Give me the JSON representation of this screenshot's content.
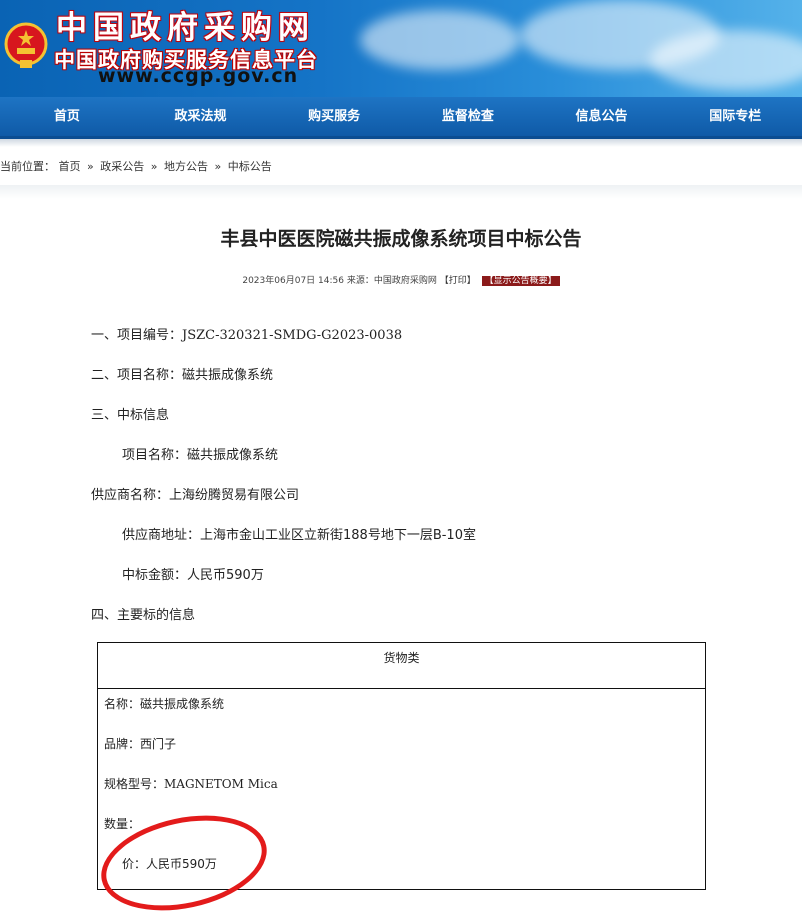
{
  "header": {
    "site_title": "中国政府采购网",
    "site_subtitle": "中国政府购买服务信息平台",
    "site_url": "www.ccgp.gov.cn"
  },
  "nav": {
    "items": [
      "首页",
      "政采法规",
      "购买服务",
      "监督检查",
      "信息公告",
      "国际专栏"
    ]
  },
  "breadcrumb": {
    "prefix": "当前位置：",
    "items": [
      "首页",
      "政采公告",
      "地方公告",
      "中标公告"
    ],
    "separator": "»"
  },
  "article": {
    "title": "丰县中医医院磁共振成像系统项目中标公告",
    "meta_date": "2023年06月07日 14:56",
    "meta_source": "来源：中国政府采购网",
    "print_label": "【打印】",
    "show_tag": "【显示公告概要】",
    "lines": {
      "project_no": "一、项目编号：JSZC-320321-SMDG-G2023-0038",
      "project_name": "二、项目名称：磁共振成像系统",
      "award_info": "三、中标信息",
      "award_project_name": "项目名称：磁共振成像系统",
      "supplier_name": "供应商名称：上海纷腾贸易有限公司",
      "supplier_addr": "供应商地址：上海市金山工业区立新街188号地下一层B-10室",
      "award_amount": "中标金额：人民币590万",
      "main_info": "四、主要标的信息"
    },
    "goods_table": {
      "header": "货物类",
      "name": "名称：磁共振成像系统",
      "brand": "品牌：西门子",
      "model": "规格型号：MAGNETOM Mica",
      "quantity": "数量：",
      "unit_price": "价：人民币590万"
    }
  },
  "colors": {
    "nav_bg": "#0f5aa7",
    "tag_bg": "#8b1a1a",
    "annotation_ring": "#e31b1b"
  }
}
